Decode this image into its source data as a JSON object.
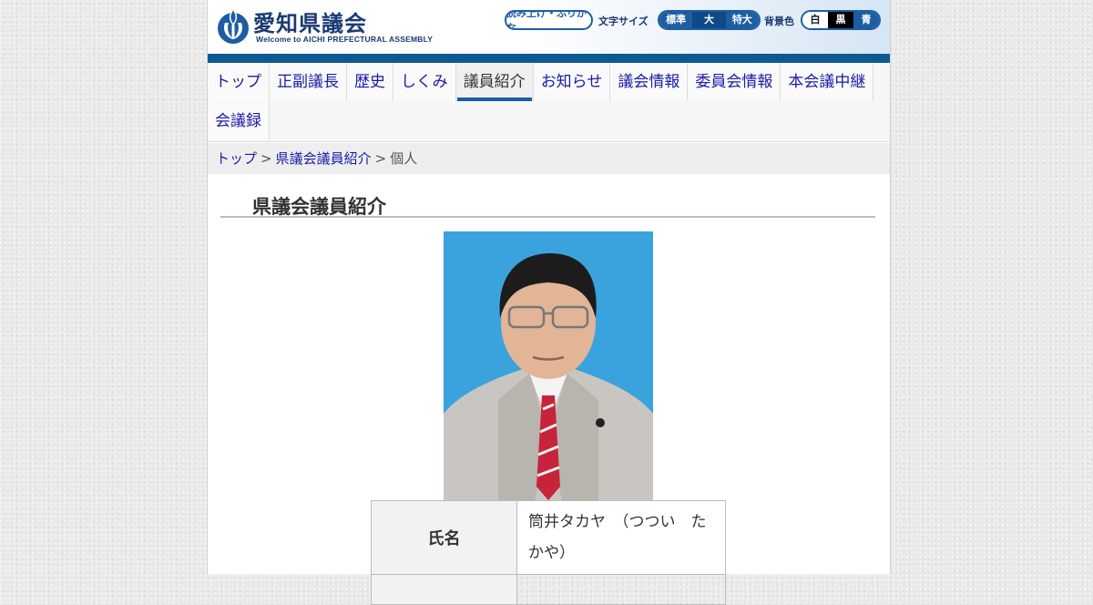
{
  "header": {
    "title": "愛知県議会",
    "subtitle": "Welcome to AICHI PREFECTURAL ASSEMBLY",
    "read_aloud_label": "読み上げ・ふりがな",
    "text_size_label": "文字サイズ",
    "text_sizes": [
      "標準",
      "大",
      "特大"
    ],
    "background_label": "背景色",
    "background_colors": [
      "白",
      "黒",
      "青"
    ],
    "logo_icon": "aichi-emblem-icon",
    "brand_color": "#1d5ea3"
  },
  "nav": {
    "items": [
      "トップ",
      "正副議長",
      "歴史",
      "しくみ",
      "議員紹介",
      "お知らせ",
      "議会情報",
      "委員会情報",
      "本会議中継",
      "会議録"
    ],
    "active": "議員紹介"
  },
  "breadcrumb": {
    "items": [
      "トップ",
      "県議会議員紹介"
    ],
    "current": "個人",
    "separator": ">"
  },
  "main": {
    "title": "県議会議員紹介",
    "profile": {
      "name_label": "氏名",
      "name_value": "筒井タカヤ　（つつい　たかや）"
    }
  }
}
